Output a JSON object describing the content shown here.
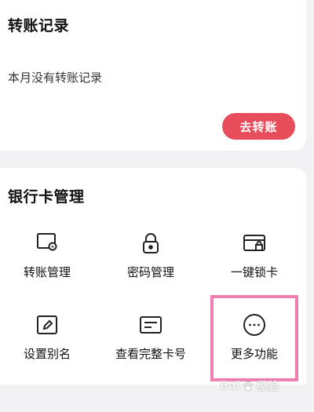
{
  "transfer_records": {
    "title": "转账记录",
    "empty_text": "本月没有转账记录",
    "action_label": "去转账"
  },
  "bank_card_management": {
    "title": "银行卡管理",
    "items": [
      {
        "label": "转账管理",
        "icon": "card-transfer-icon"
      },
      {
        "label": "密码管理",
        "icon": "lock-icon"
      },
      {
        "label": "一键锁卡",
        "icon": "card-lock-icon"
      },
      {
        "label": "设置别名",
        "icon": "edit-icon"
      },
      {
        "label": "查看完整卡号",
        "icon": "card-number-icon"
      },
      {
        "label": "更多功能",
        "icon": "more-icon"
      }
    ]
  },
  "watermark": {
    "text_left": "Bai",
    "text_right": "经验",
    "icon": "paw-icon"
  },
  "colors": {
    "accent": "#e84d5c",
    "highlight": "#f07fb1",
    "background": "#f2f2f4"
  }
}
